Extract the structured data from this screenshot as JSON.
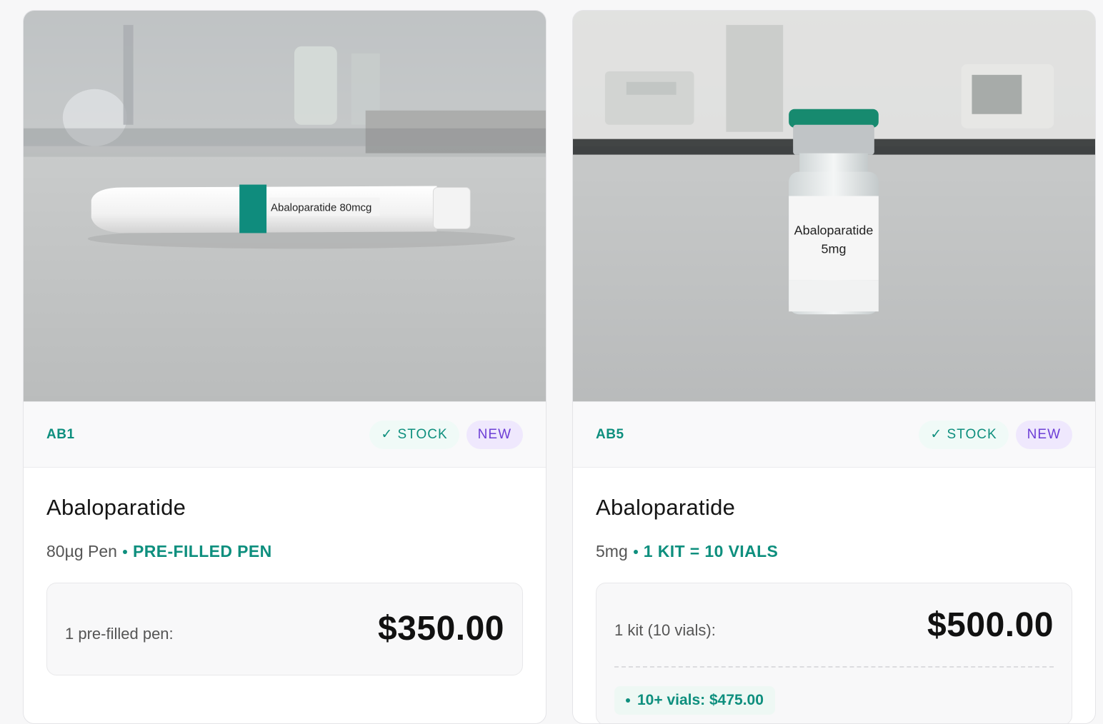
{
  "products": [
    {
      "sku": "AB1",
      "stock_badge": "✓ STOCK",
      "new_badge": "NEW",
      "name": "Abaloparatide",
      "variant": "80µg Pen",
      "format": "PRE-FILLED PEN",
      "photo_label": "Abaloparatide 80mcg",
      "price_label": "1 pre-filled pen:",
      "price": "$350.00"
    },
    {
      "sku": "AB5",
      "stock_badge": "✓ STOCK",
      "new_badge": "NEW",
      "name": "Abaloparatide",
      "variant": "5mg",
      "format": "1 KIT = 10 VIALS",
      "photo_label_line1": "Abaloparatide",
      "photo_label_line2": "5mg",
      "price_label": "1 kit (10 vials):",
      "price": "$500.00",
      "tier_text": "10+ vials: $475.00"
    }
  ],
  "colors": {
    "accent": "#0e8f7e",
    "new_badge": "#6d3fd6",
    "pen_band": "#0f8c7d",
    "vial_cap": "#178a6f"
  }
}
